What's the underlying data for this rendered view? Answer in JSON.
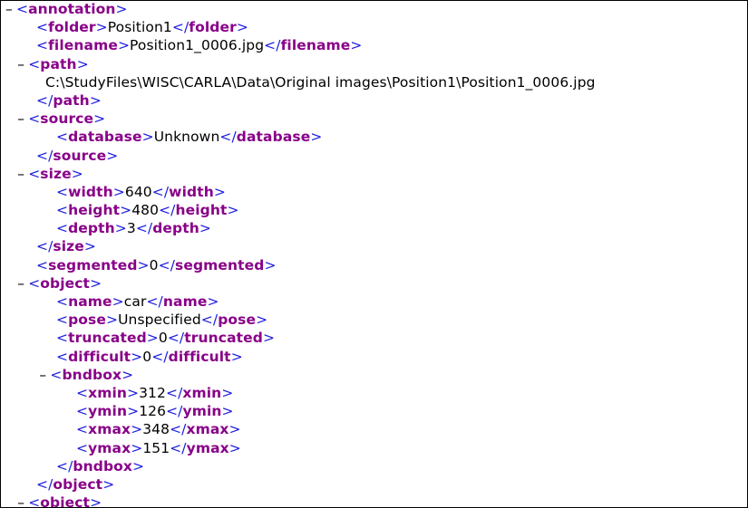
{
  "colors": {
    "tag": "#880088",
    "punct": "#1c1ce0",
    "text": "#000000"
  },
  "toggle_icon": "minus",
  "lines": [
    {
      "indent": 0,
      "toggle": "-",
      "open": "annotation",
      "text": "",
      "close": ""
    },
    {
      "indent": 1,
      "toggle": "",
      "open": "folder",
      "text": "Position1",
      "close": "folder"
    },
    {
      "indent": 1,
      "toggle": "",
      "open": "filename",
      "text": "Position1_0006.jpg",
      "close": "filename"
    },
    {
      "indent": 0.6,
      "toggle": "-",
      "open": "path",
      "text": "",
      "close": ""
    },
    {
      "indent": 2,
      "toggle": "",
      "open": "",
      "text": "C:\\StudyFiles\\WISC\\CARLA\\Data\\Original images\\Position1\\Position1_0006.jpg",
      "close": ""
    },
    {
      "indent": 1,
      "toggle": "",
      "open": "",
      "text": "",
      "close": "path"
    },
    {
      "indent": 0.6,
      "toggle": "-",
      "open": "source",
      "text": "",
      "close": ""
    },
    {
      "indent": 2,
      "toggle": "",
      "open": "database",
      "text": "Unknown",
      "close": "database"
    },
    {
      "indent": 1,
      "toggle": "",
      "open": "",
      "text": "",
      "close": "source"
    },
    {
      "indent": 0.6,
      "toggle": "-",
      "open": "size",
      "text": "",
      "close": ""
    },
    {
      "indent": 2,
      "toggle": "",
      "open": "width",
      "text": "640",
      "close": "width"
    },
    {
      "indent": 2,
      "toggle": "",
      "open": "height",
      "text": "480",
      "close": "height"
    },
    {
      "indent": 2,
      "toggle": "",
      "open": "depth",
      "text": "3",
      "close": "depth"
    },
    {
      "indent": 1,
      "toggle": "",
      "open": "",
      "text": "",
      "close": "size"
    },
    {
      "indent": 1,
      "toggle": "",
      "open": "segmented",
      "text": "0",
      "close": "segmented"
    },
    {
      "indent": 0.6,
      "toggle": "-",
      "open": "object",
      "text": "",
      "close": ""
    },
    {
      "indent": 2,
      "toggle": "",
      "open": "name",
      "text": "car",
      "close": "name"
    },
    {
      "indent": 2,
      "toggle": "",
      "open": "pose",
      "text": "Unspecified",
      "close": "pose"
    },
    {
      "indent": 2,
      "toggle": "",
      "open": "truncated",
      "text": "0",
      "close": "truncated"
    },
    {
      "indent": 2,
      "toggle": "",
      "open": "difficult",
      "text": "0",
      "close": "difficult"
    },
    {
      "indent": 1.7,
      "toggle": "-",
      "open": "bndbox",
      "text": "",
      "close": ""
    },
    {
      "indent": 3,
      "toggle": "",
      "open": "xmin",
      "text": "312",
      "close": "xmin"
    },
    {
      "indent": 3,
      "toggle": "",
      "open": "ymin",
      "text": "126",
      "close": "ymin"
    },
    {
      "indent": 3,
      "toggle": "",
      "open": "xmax",
      "text": "348",
      "close": "xmax"
    },
    {
      "indent": 3,
      "toggle": "",
      "open": "ymax",
      "text": "151",
      "close": "ymax"
    },
    {
      "indent": 2,
      "toggle": "",
      "open": "",
      "text": "",
      "close": "bndbox"
    },
    {
      "indent": 1,
      "toggle": "",
      "open": "",
      "text": "",
      "close": "object"
    },
    {
      "indent": 0.6,
      "toggle": "-",
      "open": "object",
      "text": "",
      "close": ""
    }
  ]
}
